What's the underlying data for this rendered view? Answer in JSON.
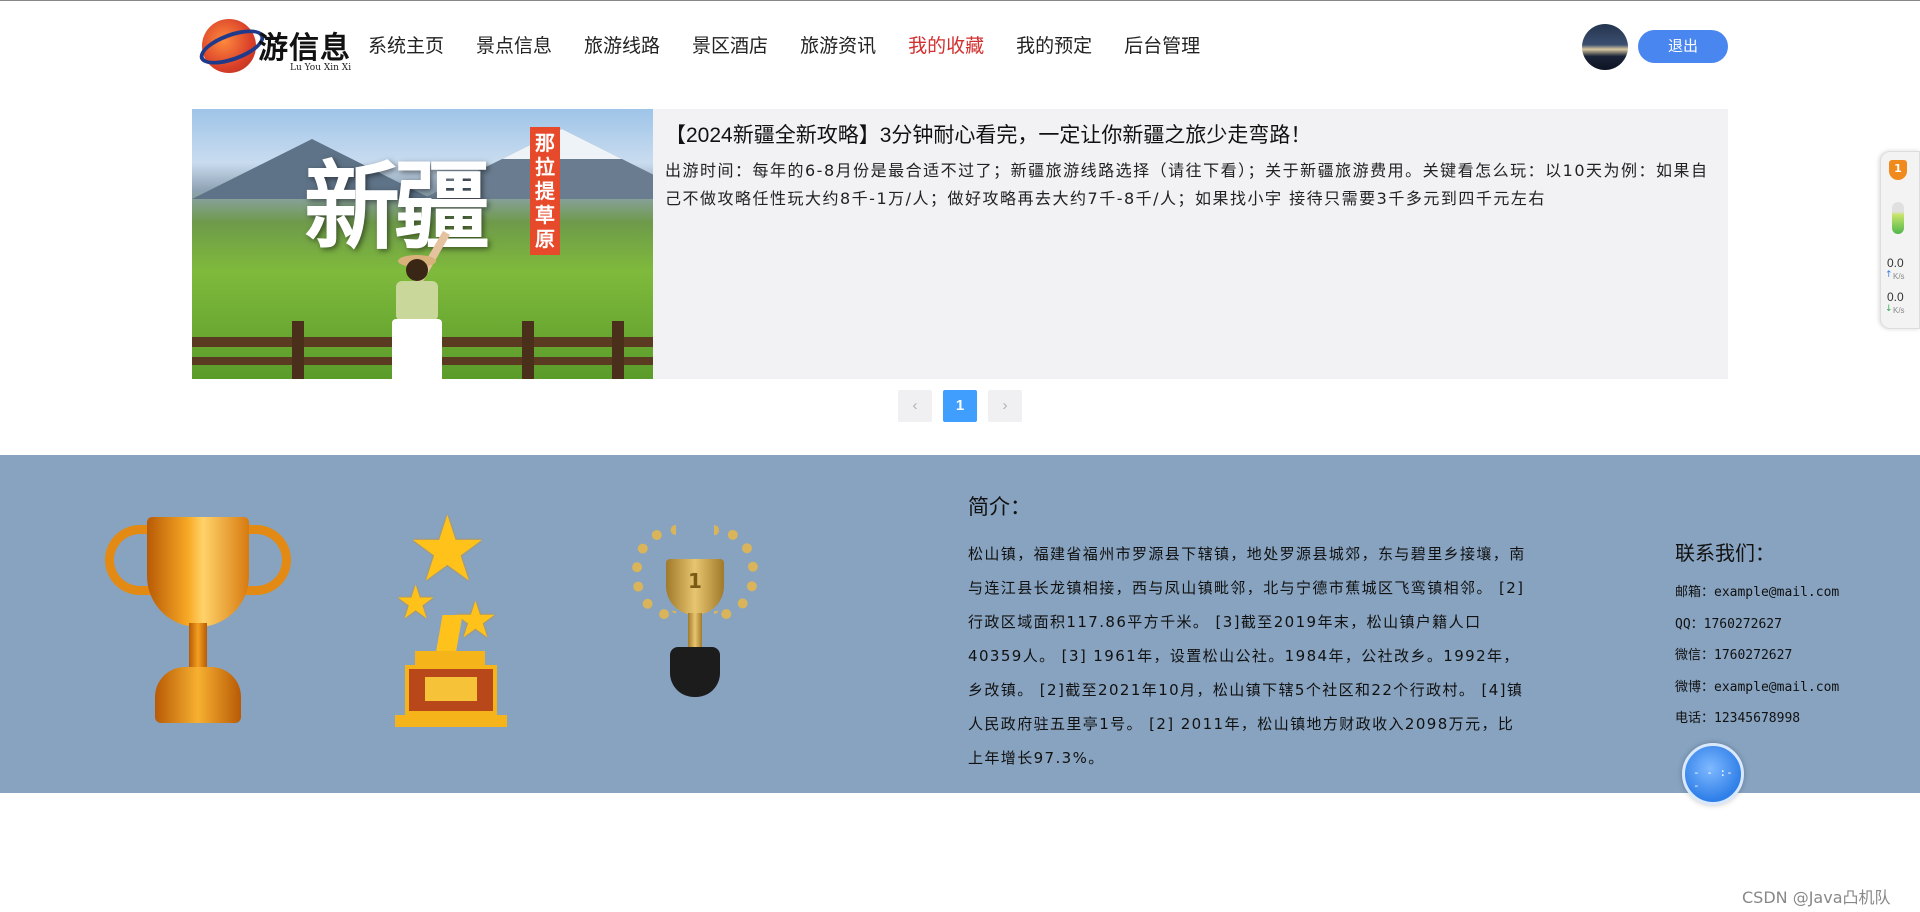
{
  "header": {
    "logo_text": "游信息",
    "logo_sub": "Lu You Xin Xi",
    "nav": [
      {
        "label": "系统主页",
        "active": false
      },
      {
        "label": "景点信息",
        "active": false
      },
      {
        "label": "旅游线路",
        "active": false
      },
      {
        "label": "景区酒店",
        "active": false
      },
      {
        "label": "旅游资讯",
        "active": false
      },
      {
        "label": "我的收藏",
        "active": true
      },
      {
        "label": "我的预定",
        "active": false
      },
      {
        "label": "后台管理",
        "active": false
      }
    ],
    "logout_label": "退出"
  },
  "article": {
    "image_title": "新疆",
    "image_tag": "那拉提草原",
    "title": "【2024新疆全新攻略】3分钟耐心看完，一定让你新疆之旅少走弯路！",
    "description": "出游时间：每年的6-8月份是最合适不过了；新疆旅游线路选择（请往下看）；关于新疆旅游费用。关键看怎么玩：以10天为例：如果自己不做攻略任性玩大约8千-1万/人；做好攻略再去大约7千-8千/人；如果找小宇 接待只需要3千多元到四千元左右"
  },
  "pagination": {
    "prev": "‹",
    "current": "1",
    "next": "›"
  },
  "footer": {
    "trophy_number": "1",
    "intro_title": "简介：",
    "intro_text": "松山镇，福建省福州市罗源县下辖镇，地处罗源县城郊，东与碧里乡接壤，南与连江县长龙镇相接，西与凤山镇毗邻，北与宁德市蕉城区飞鸾镇相邻。 [2]行政区域面积117.86平方千米。 [3]截至2019年末，松山镇户籍人口40359人。 [3] 1961年，设置松山公社。1984年，公社改乡。1992年，乡改镇。 [2]截至2021年10月，松山镇下辖5个社区和22个行政村。 [4]镇人民政府驻五里亭1号。 [2] 2011年，松山镇地方财政收入2098万元，比上年增长97.3%。",
    "contact_title": "联系我们：",
    "contact": [
      "邮箱：example@mail.com",
      "QQ：1760272627",
      "微信：1760272627",
      "微博：example@mail.com",
      "电话：12345678998"
    ]
  },
  "widget": {
    "badge": "1",
    "up_value": "0.0",
    "up_unit": "K/s",
    "down_value": "0.0",
    "down_unit": "K/s"
  },
  "watermark": "CSDN @Java凸机队",
  "colors": {
    "accent": "#4a86f0",
    "active_nav": "#d32f2f",
    "footer_bg": "#87a3c0",
    "page_current": "#409eff"
  }
}
